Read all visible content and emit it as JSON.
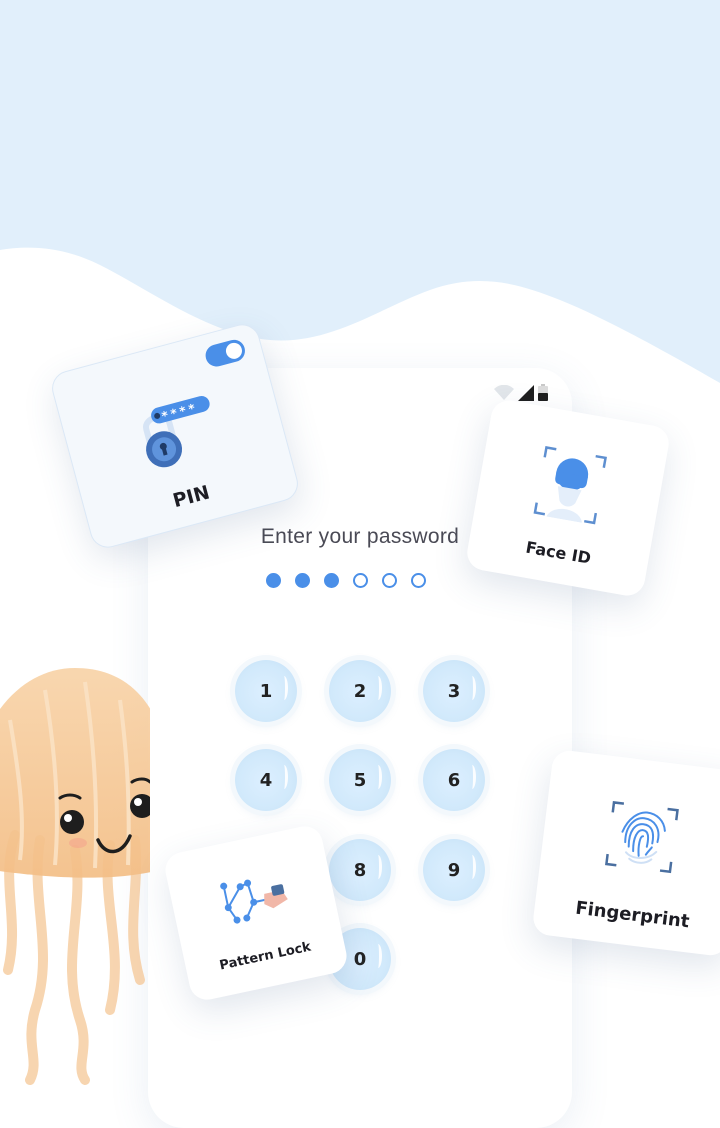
{
  "status_bar": {
    "icons": [
      "wifi-icon",
      "signal-icon",
      "battery-icon"
    ]
  },
  "lock_screen": {
    "prompt": "Enter your password",
    "pin_dots": {
      "total": 6,
      "filled": 3
    },
    "keys": [
      "1",
      "2",
      "3",
      "4",
      "5",
      "6",
      "8",
      "9",
      "0"
    ]
  },
  "cards": {
    "pin": {
      "label": "PIN",
      "toggle_on": true,
      "mask": "****"
    },
    "face_id": {
      "label": "Face ID"
    },
    "fingerprint": {
      "label": "Fingerprint"
    },
    "pattern_lock": {
      "label": "Pattern Lock"
    }
  },
  "colors": {
    "accent": "#4a8fe8",
    "background_top": "#e1effb",
    "key_fill": "#d4eafb",
    "jellyfish": "#f6c993"
  }
}
